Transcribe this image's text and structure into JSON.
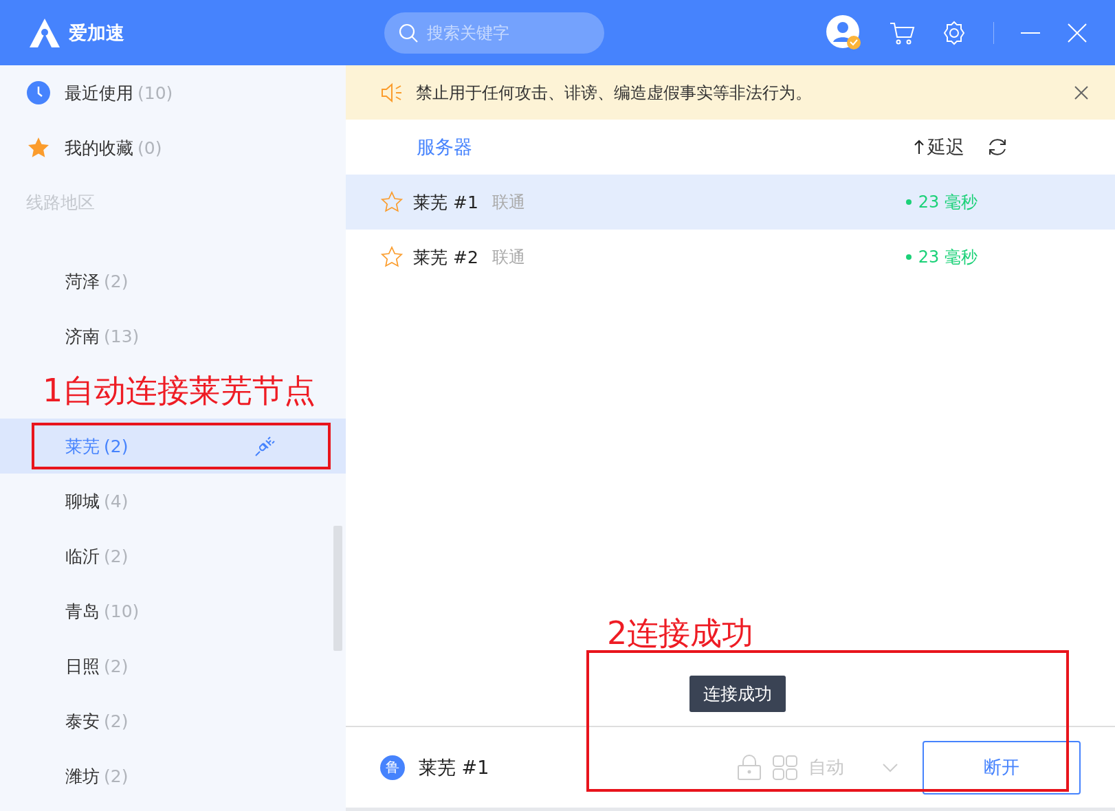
{
  "app": {
    "name": "爱加速"
  },
  "search": {
    "placeholder": "搜索关键字"
  },
  "sidebar": {
    "quick": [
      {
        "kind": "clock",
        "label": "最近使用",
        "count": "(10)"
      },
      {
        "kind": "star",
        "label": "我的收藏",
        "count": "(0)"
      }
    ],
    "section_title": "线路地区",
    "regions": [
      {
        "kind": "region",
        "label": "菏泽",
        "count": "(2)",
        "selected": false,
        "connected": false,
        "annotated": false
      },
      {
        "kind": "region",
        "label": "济南",
        "count": "(13)",
        "selected": false,
        "connected": false,
        "annotated": false
      },
      {
        "kind": "annotation",
        "text": "1自动连接莱芜节点"
      },
      {
        "kind": "region",
        "label": "莱芜",
        "count": "(2)",
        "selected": true,
        "connected": true,
        "annotated": true
      },
      {
        "kind": "region",
        "label": "聊城",
        "count": "(4)",
        "selected": false,
        "connected": false,
        "annotated": false
      },
      {
        "kind": "region",
        "label": "临沂",
        "count": "(2)",
        "selected": false,
        "connected": false,
        "annotated": false
      },
      {
        "kind": "region",
        "label": "青岛",
        "count": "(10)",
        "selected": false,
        "connected": false,
        "annotated": false
      },
      {
        "kind": "region",
        "label": "日照",
        "count": "(2)",
        "selected": false,
        "connected": false,
        "annotated": false
      },
      {
        "kind": "region",
        "label": "泰安",
        "count": "(2)",
        "selected": false,
        "connected": false,
        "annotated": false
      },
      {
        "kind": "region",
        "label": "潍坊",
        "count": "(2)",
        "selected": false,
        "connected": false,
        "annotated": false
      }
    ]
  },
  "notice": {
    "text": "禁止用于任何攻击、诽谤、编造虚假事实等非法行为。"
  },
  "table": {
    "columns": [
      {
        "label": "服务器",
        "sorted": false
      },
      {
        "label": "延迟",
        "sorted": true
      }
    ],
    "rows": [
      {
        "name": "莱芜 #1",
        "isp": "联通",
        "latency": "23 毫秒",
        "favorite": false,
        "selected": true
      },
      {
        "name": "莱芜 #2",
        "isp": "联通",
        "latency": "23 毫秒",
        "favorite": false,
        "selected": false
      }
    ]
  },
  "toast": {
    "text": "连接成功"
  },
  "result_annotation": {
    "text": "2连接成功"
  },
  "footer": {
    "region_badge": "鲁",
    "server": "莱芜 #1",
    "mode": "自动",
    "button": "断开"
  }
}
